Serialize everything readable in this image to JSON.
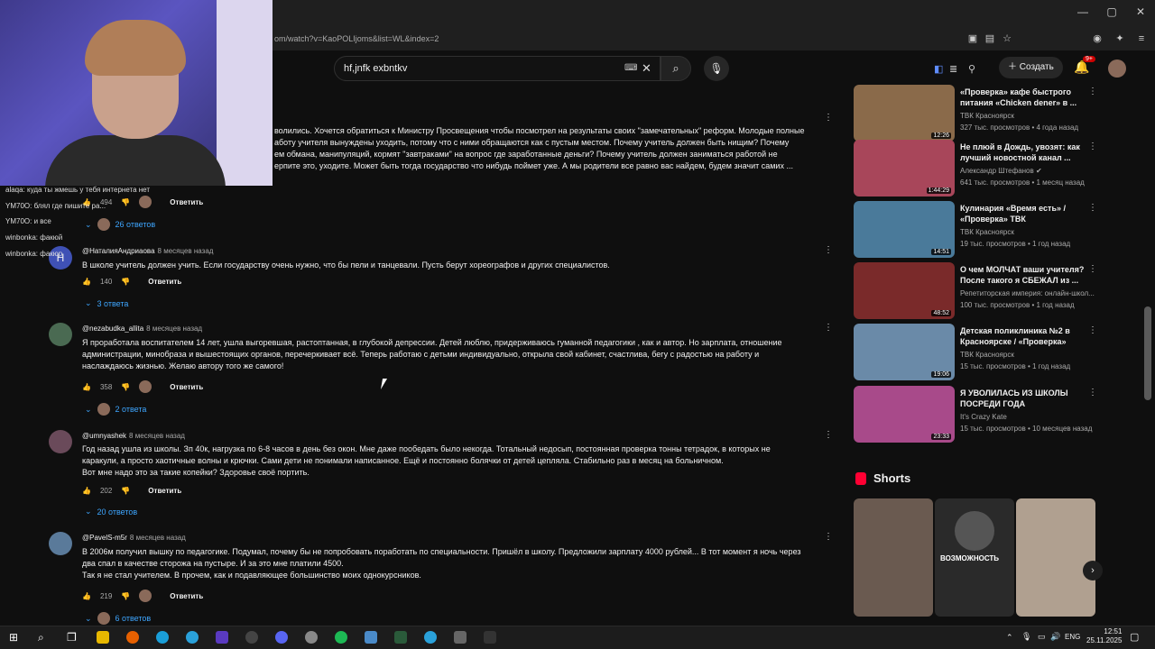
{
  "browser": {
    "url": "om/watch?v=KaoPOLIjoms&list=WL&index=2",
    "window_controls": [
      "—",
      "▢",
      "✕"
    ]
  },
  "header": {
    "search_value": "hf,jnfk exbntkv",
    "create_label": "Создать",
    "notifications_badge": "9+"
  },
  "chat": [
    {
      "text": "alaqa: куда ты жмешь у тебя интернета нет"
    },
    {
      "text": "YM70O: блял где пишите ра..."
    },
    {
      "text": "YM70O: и все"
    },
    {
      "text": "winbonka: факюй"
    },
    {
      "text": "winbonka: факюр"
    }
  ],
  "top_comment": {
    "lines": [
      "волились. Хочется обратиться к Министру Просвещения чтобы посмотрел на результаты своих \"замечательных\" реформ. Молодые полные",
      "аботу учителя вынуждены уходить, потому что с ними обращаются как с пустым местом.  Почему учитель должен быть нищим? Почему",
      "ем обмана, манипуляций, кормят \"завтраками\" на вопрос где заработанные деньги? Почему учитель должен заниматься работой не",
      "ерпите это, уходите. Может быть тогда государство что нибудь поймет уже. А мы родители все равно вас найдем, будем значит самих ..."
    ],
    "likes": "494",
    "reply_label": "Ответить",
    "replies_label": "26 ответов"
  },
  "comments": [
    {
      "author": "@НаталияАндриаова",
      "time": "8 месяцев назад",
      "avatar_letter": "Н",
      "avatar_color": "#3f51b5",
      "text": [
        "В школе учитель должен учить. Если государству очень нужно, что бы пели и танцевали. Пусть берут хореографов и других специалистов."
      ],
      "likes": "140",
      "reply_label": "Ответить",
      "replies_label": "3 ответа"
    },
    {
      "author": "@nezabudka_allita",
      "time": "8 месяцев назад",
      "avatar_color": "#4a6a52",
      "text": [
        "Я проработала воспитателем 14 лет, ушла выгоревшая, растоптанная, в глубокой депрессии. Детей люблю, придерживаюсь гуманной педагогики , как и автор. Но зарплата, отношение",
        "администрации, минобраза и вышестоящих органов, перечеркивает всё. Теперь работаю с детьми индивидуально, открыла свой кабинет, счастлива, бегу с радостью на работу и",
        "наслаждаюсь жизнью.     Желаю автору того же самого!"
      ],
      "likes": "358",
      "reply_label": "Ответить",
      "replies_label": "2 ответа"
    },
    {
      "author": "@umnyashek",
      "time": "8 месяцев назад",
      "avatar_color": "#6a4a5a",
      "text": [
        "Год назад ушла из школы. Зп 40к, нагрузка по 6-8 часов в день без окон. Мне даже пообедать было некогда. Тотальный недосып, постоянная проверка тонны тетрадок, в которых не",
        "каракули, а просто хаотичные волны и крючки. Сами дети не понимали написанное. Ещё и постоянно болячки от детей цепляла. Стабильно раз в месяц на больничном.",
        "Вот мне надо это за такие копейки? Здоровье своё портить."
      ],
      "likes": "202",
      "reply_label": "Ответить",
      "replies_label": "20 ответов"
    },
    {
      "author": "@PavelS-m5r",
      "time": "8 месяцев назад",
      "avatar_color": "#5a7a9a",
      "text": [
        "В 2006м получил вышку по педагогике. Подумал, почему бы не попробовать поработать по специальности. Пришёл в школу. Предложили зарплату 4000 рублей... В тот момент я ночь через",
        "два спал в качестве сторожа на пустыре. И за это мне платили 4500.",
        "Так я не стал учителем. В прочем, как и подавляющее большинство моих однокурсников."
      ],
      "likes": "219",
      "reply_label": "Ответить",
      "replies_label": "6 ответов"
    }
  ],
  "sidebar": [
    {
      "title": "«Проверка» кафе быстрого питания «Chicken dener» в ...",
      "channel": "ТВК Красноярск",
      "meta": "327 тыс. просмотров • 4 года назад",
      "duration": "12:26",
      "color": "#8a6a4a"
    },
    {
      "title": "Не плюй в Дождь, увозят: как лучший новостной канал ...",
      "channel": "Александр Штефанов ✔",
      "meta": "641 тыс. просмотров • 1 месяц назад",
      "duration": "1:44:29",
      "color": "#a8465a"
    },
    {
      "title": "Кулинария «Время есть» / «Проверка» ТВК",
      "channel": "ТВК Красноярск",
      "meta": "19 тыс. просмотров • 1 год назад",
      "duration": "14:51",
      "color": "#4a7a9a"
    },
    {
      "title": "О чем МОЛЧАТ ваши учителя? После такого я СБЕЖАЛ из ...",
      "channel": "Репетиторская империя: онлайн-школ...",
      "meta": "100 тыс. просмотров • 1 год назад",
      "duration": "48:52",
      "color": "#7a2a2a"
    },
    {
      "title": "Детская поликлиника №2 в Красноярске / «Проверка»",
      "channel": "ТВК Красноярск",
      "meta": "15 тыс. просмотров • 1 год назад",
      "duration": "19:06",
      "color": "#6a8aa8"
    },
    {
      "title": "Я УВОЛИЛАСЬ ИЗ ШКОЛЫ ПОСРЕДИ ГОДА",
      "channel": "It's Crazy Kate",
      "meta": "15 тыс. просмотров • 10 месяцев назад",
      "duration": "23:33",
      "color": "#a84a8a"
    }
  ],
  "shorts": {
    "title": "Shorts",
    "items": [
      {
        "color": "#6a5a50",
        "caption": ""
      },
      {
        "color": "#2a2a2a",
        "caption": "ВОЗМОЖНОСТЬ"
      },
      {
        "color": "#b0a090",
        "caption": ""
      }
    ]
  },
  "taskbar": {
    "lang": "ENG",
    "time": "12:51",
    "date": "25.11.2025"
  }
}
